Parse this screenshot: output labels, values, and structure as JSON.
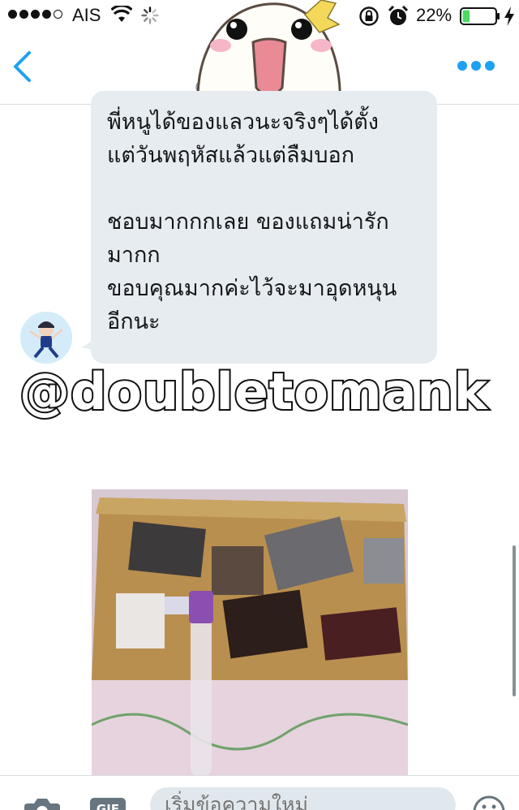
{
  "status_bar": {
    "carrier": "AIS",
    "battery_percent": "22%",
    "battery_level": 0.22,
    "icons": [
      "wifi-icon",
      "spinner-icon",
      "lock-rotation-icon",
      "alarm-icon",
      "battery-icon",
      "charging-icon"
    ]
  },
  "nav": {
    "handle_partial": "@",
    "icons": [
      "back-icon",
      "more-icon"
    ],
    "accent_color": "#1da1f2"
  },
  "message": {
    "lines_1": [
      "พี่หนูได้ของแลวนะจริงๆได้ตั้ง",
      "แต่วันพฤหัสแล้วแต่ลืมบอก"
    ],
    "lines_2": [
      "ชอบมากกกเลย ของแถมน่ารัก",
      "มากก",
      "ขอบคุณมากค่ะไว้จะมาอุดหนุน",
      "อีกนะ"
    ],
    "bubble_color": "#e6ecf0"
  },
  "watermark": "@doubletomank",
  "compose": {
    "placeholder": "เริ่มข้อความใหม่",
    "gif_label": "GIF"
  }
}
